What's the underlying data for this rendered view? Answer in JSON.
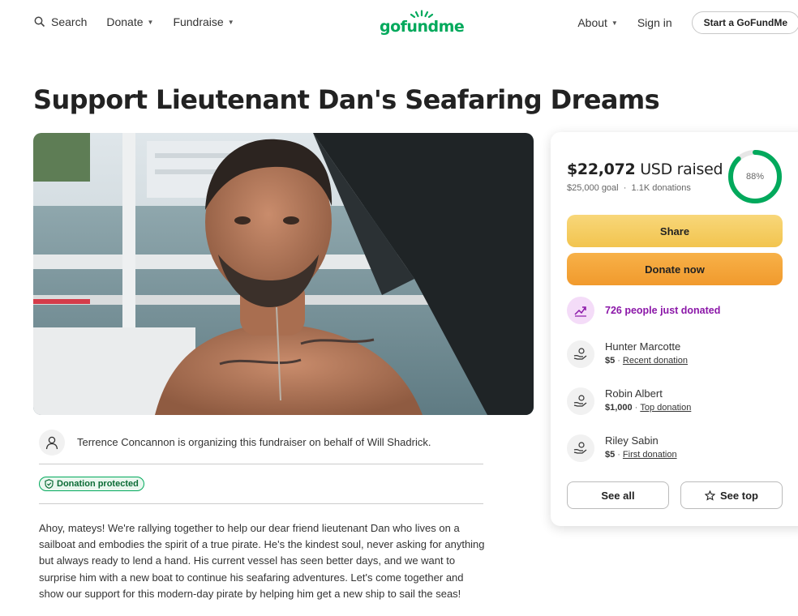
{
  "header": {
    "search_label": "Search",
    "donate_label": "Donate",
    "fundraise_label": "Fundraise",
    "logo_text": "gofundme",
    "about_label": "About",
    "signin_label": "Sign in",
    "start_label": "Start a GoFundMe"
  },
  "campaign": {
    "title": "Support Lieutenant Dan's Seafaring Dreams",
    "organizer_text": "Terrence Concannon is organizing this fundraiser on behalf of Will Shadrick.",
    "protected_label": "Donation protected",
    "story": "Ahoy, mateys! We're rallying together to help our dear friend lieutenant Dan who lives on a sailboat and embodies the spirit of a true pirate. He's the kindest soul, never asking for anything but always ready to lend a hand. His current vessel has seen better days, and we want to surprise him with a new boat to continue his seafaring adventures. Let's come together and show our support for this modern-day pirate by helping him get a new ship to sail the seas!"
  },
  "card": {
    "raised_amount": "$22,072",
    "raised_suffix": "USD raised",
    "goal": "$25,000 goal",
    "donations": "1.1K donations",
    "progress_fraction": 0.88,
    "progress_label": "88%",
    "share_label": "Share",
    "donate_label": "Donate now",
    "just_donated": "726 people just donated",
    "donors": [
      {
        "name": "Hunter Marcotte",
        "amount": "$5",
        "tag": "Recent donation"
      },
      {
        "name": "Robin Albert",
        "amount": "$1,000",
        "tag": "Top donation"
      },
      {
        "name": "Riley Sabin",
        "amount": "$5",
        "tag": "First donation"
      }
    ],
    "see_all_label": "See all",
    "see_top_label": "See top"
  },
  "colors": {
    "brand_green": "#02a95c",
    "share_yellow": "#f2c44e",
    "donate_orange": "#f19a2d",
    "purple": "#8b17a8"
  }
}
